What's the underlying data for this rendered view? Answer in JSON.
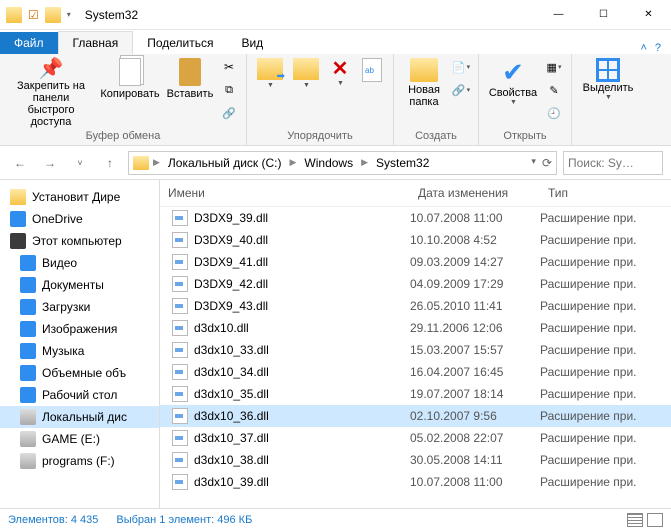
{
  "titlebar": {
    "title": "System32"
  },
  "win": {
    "min": "—",
    "max": "☐",
    "close": "✕"
  },
  "tabs": {
    "file": "Файл",
    "home": "Главная",
    "share": "Поделиться",
    "view": "Вид",
    "collapse": "˄",
    "help": "?"
  },
  "ribbon": {
    "pin": "Закрепить на панели\nбыстрого доступа",
    "copy": "Копировать",
    "paste": "Вставить",
    "clipboard_group": "Буфер обмена",
    "organize_group": "Упорядочить",
    "newfolder": "Новая\nпапка",
    "new_group": "Создать",
    "properties": "Свойства",
    "open_group": "Открыть",
    "select": "Выделить",
    "delete_x": "✕"
  },
  "nav": {
    "back": "←",
    "fwd": "→",
    "up": "↑",
    "recent": "˅",
    "refresh": "⟳"
  },
  "breadcrumbs": [
    "Локальный диск (C:)",
    "Windows",
    "System32"
  ],
  "search": {
    "placeholder": "Поиск: Sy…"
  },
  "sidebar": {
    "items": [
      {
        "label": "Установит Дире",
        "icon": "folder",
        "top": true
      },
      {
        "label": "OneDrive",
        "icon": "cloud",
        "top": true
      },
      {
        "label": "Этот компьютер",
        "icon": "pc",
        "top": true
      },
      {
        "label": "Видео",
        "icon": "video"
      },
      {
        "label": "Документы",
        "icon": "doc"
      },
      {
        "label": "Загрузки",
        "icon": "down"
      },
      {
        "label": "Изображения",
        "icon": "img"
      },
      {
        "label": "Музыка",
        "icon": "music"
      },
      {
        "label": "Объемные объ",
        "icon": "cube"
      },
      {
        "label": "Рабочий стол",
        "icon": "desk"
      },
      {
        "label": "Локальный дис",
        "icon": "disk",
        "sel": true
      },
      {
        "label": "GAME (E:)",
        "icon": "disk"
      },
      {
        "label": "programs (F:)",
        "icon": "disk"
      }
    ]
  },
  "columns": {
    "name": "Имени",
    "date": "Дата изменения",
    "type": "Тип"
  },
  "files": [
    {
      "name": "D3DX9_39.dll",
      "date": "10.07.2008 11:00",
      "type": "Расширение при."
    },
    {
      "name": "D3DX9_40.dll",
      "date": "10.10.2008 4:52",
      "type": "Расширение при."
    },
    {
      "name": "D3DX9_41.dll",
      "date": "09.03.2009 14:27",
      "type": "Расширение при."
    },
    {
      "name": "D3DX9_42.dll",
      "date": "04.09.2009 17:29",
      "type": "Расширение при."
    },
    {
      "name": "D3DX9_43.dll",
      "date": "26.05.2010 11:41",
      "type": "Расширение при."
    },
    {
      "name": "d3dx10.dll",
      "date": "29.11.2006 12:06",
      "type": "Расширение при."
    },
    {
      "name": "d3dx10_33.dll",
      "date": "15.03.2007 15:57",
      "type": "Расширение при."
    },
    {
      "name": "d3dx10_34.dll",
      "date": "16.04.2007 16:45",
      "type": "Расширение при."
    },
    {
      "name": "d3dx10_35.dll",
      "date": "19.07.2007 18:14",
      "type": "Расширение при."
    },
    {
      "name": "d3dx10_36.dll",
      "date": "02.10.2007 9:56",
      "type": "Расширение при.",
      "sel": true
    },
    {
      "name": "d3dx10_37.dll",
      "date": "05.02.2008 22:07",
      "type": "Расширение при."
    },
    {
      "name": "d3dx10_38.dll",
      "date": "30.05.2008 14:11",
      "type": "Расширение при."
    },
    {
      "name": "d3dx10_39.dll",
      "date": "10.07.2008 11:00",
      "type": "Расширение при."
    }
  ],
  "status": {
    "count": "Элементов: 4 435",
    "selection": "Выбран 1 элемент: 496 КБ"
  }
}
